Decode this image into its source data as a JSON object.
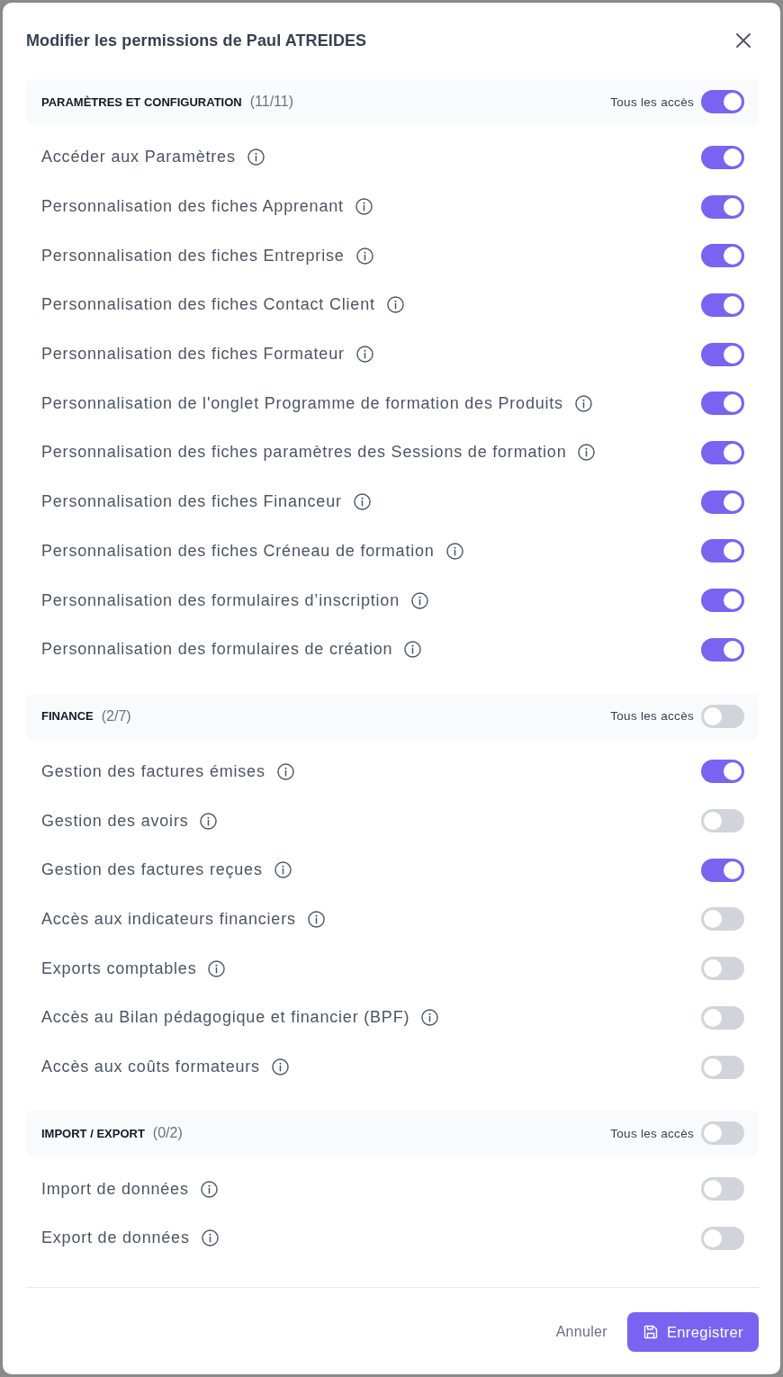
{
  "dialog": {
    "title": "Modifier les permissions de Paul ATREIDES"
  },
  "sections": [
    {
      "title": "PARAMÈTRES ET CONFIGURATION",
      "count": "(11/11)",
      "all_access_label": "Tous les accès",
      "all_access_on": true,
      "permissions": [
        {
          "label": "Accéder aux Paramètres",
          "on": true
        },
        {
          "label": "Personnalisation des fiches Apprenant",
          "on": true
        },
        {
          "label": "Personnalisation des fiches Entreprise",
          "on": true
        },
        {
          "label": "Personnalisation des fiches Contact Client",
          "on": true
        },
        {
          "label": "Personnalisation des fiches Formateur",
          "on": true
        },
        {
          "label": "Personnalisation de l'onglet Programme de formation des Produits",
          "on": true
        },
        {
          "label": "Personnalisation des fiches paramètres des Sessions de formation",
          "on": true
        },
        {
          "label": "Personnalisation des fiches Financeur",
          "on": true
        },
        {
          "label": "Personnalisation des fiches Créneau de formation",
          "on": true
        },
        {
          "label": "Personnalisation des formulaires d’inscription",
          "on": true
        },
        {
          "label": "Personnalisation des formulaires de création",
          "on": true
        }
      ]
    },
    {
      "title": "FINANCE",
      "count": "(2/7)",
      "all_access_label": "Tous les accès",
      "all_access_on": false,
      "permissions": [
        {
          "label": "Gestion des factures émises",
          "on": true
        },
        {
          "label": "Gestion des avoirs",
          "on": false
        },
        {
          "label": "Gestion des factures reçues",
          "on": true
        },
        {
          "label": "Accès aux indicateurs financiers",
          "on": false
        },
        {
          "label": "Exports comptables",
          "on": false
        },
        {
          "label": "Accès au Bilan pédagogique et financier (BPF)",
          "on": false
        },
        {
          "label": "Accès aux coûts formateurs",
          "on": false
        }
      ]
    },
    {
      "title": "IMPORT / EXPORT",
      "count": "(0/2)",
      "all_access_label": "Tous les accès",
      "all_access_on": false,
      "permissions": [
        {
          "label": "Import de données",
          "on": false
        },
        {
          "label": "Export de données",
          "on": false
        }
      ]
    }
  ],
  "footer": {
    "cancel": "Annuler",
    "save": "Enregistrer"
  }
}
